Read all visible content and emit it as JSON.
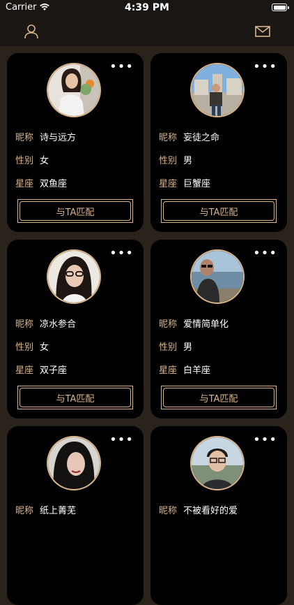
{
  "status_bar": {
    "carrier": "Carrier",
    "time": "4:39 PM"
  },
  "nav": {
    "profile_icon": "person-icon",
    "mail_icon": "mail-icon"
  },
  "labels": {
    "nickname": "昵称",
    "gender": "性别",
    "zodiac": "星座",
    "match": "与TA匹配"
  },
  "colors": {
    "accent": "#d9b58c",
    "card_bg": "#000000",
    "page_bg": "#2a231c"
  },
  "users": [
    {
      "nickname": "诗与远方",
      "gender": "女",
      "zodiac": "双鱼座"
    },
    {
      "nickname": "妄徒之命",
      "gender": "男",
      "zodiac": "巨蟹座"
    },
    {
      "nickname": "凉水参合",
      "gender": "女",
      "zodiac": "双子座"
    },
    {
      "nickname": "爱情简单化",
      "gender": "男",
      "zodiac": "白羊座"
    },
    {
      "nickname": "纸上菁芜"
    },
    {
      "nickname": "不被看好的爱"
    }
  ]
}
